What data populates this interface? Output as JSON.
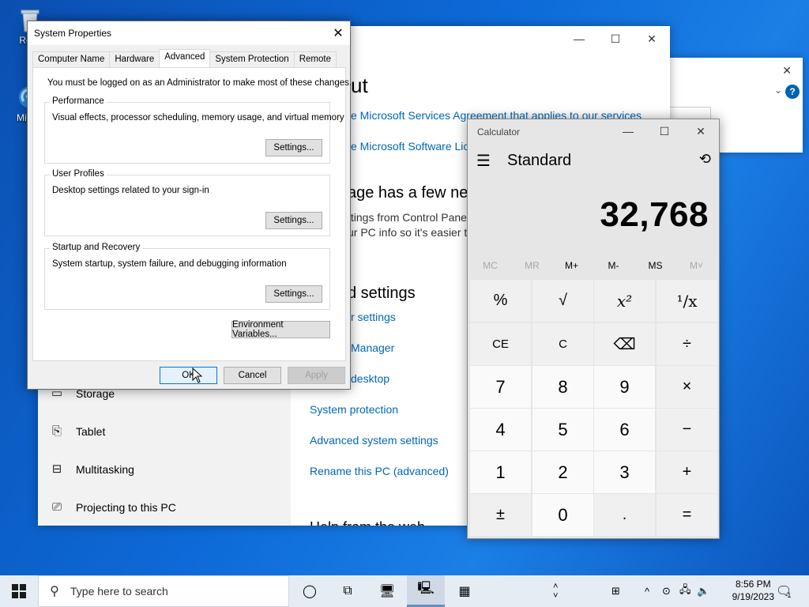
{
  "desktop": {
    "icons": [
      {
        "label": "Recy"
      },
      {
        "label": "Micr E"
      }
    ]
  },
  "settings_window": {
    "heading_about": "ut",
    "links_top": [
      "e Microsoft Services Agreement that applies to our services",
      "e Microsoft Software Lice"
    ],
    "heading_page": "age has a few ne",
    "desc_lines": [
      "ttings from Control Pane",
      "ur PC info so it's easier to"
    ],
    "heading_related": "d settings",
    "related_links": [
      "r settings",
      "Manager",
      "desktop",
      "System protection",
      "Advanced system settings",
      "Rename this PC (advanced)"
    ],
    "help_heading": "Help from the web",
    "nav": [
      {
        "label": "Storage",
        "icon": "storage-icon"
      },
      {
        "label": "Tablet",
        "icon": "tablet-icon"
      },
      {
        "label": "Multitasking",
        "icon": "multitasking-icon"
      },
      {
        "label": "Projecting to this PC",
        "icon": "projecting-icon"
      }
    ]
  },
  "system_properties": {
    "title": "System Properties",
    "tabs": [
      "Computer Name",
      "Hardware",
      "Advanced",
      "System Protection",
      "Remote"
    ],
    "active_tab": "Advanced",
    "admin_note": "You must be logged on as an Administrator to make most of these changes.",
    "groups": [
      {
        "label": "Performance",
        "desc": "Visual effects, processor scheduling, memory usage, and virtual memory",
        "button": "Settings..."
      },
      {
        "label": "User Profiles",
        "desc": "Desktop settings related to your sign-in",
        "button": "Settings..."
      },
      {
        "label": "Startup and Recovery",
        "desc": "System startup, system failure, and debugging information",
        "button": "Settings..."
      }
    ],
    "env_button": "Environment Variables...",
    "ok": "OK",
    "cancel": "Cancel",
    "apply": "Apply"
  },
  "calculator": {
    "title": "Calculator",
    "mode": "Standard",
    "display": "32,768",
    "memory": [
      "MC",
      "MR",
      "M+",
      "M-",
      "MS",
      "M˅"
    ],
    "keys": [
      [
        "%",
        "√",
        "x²",
        "¹/x"
      ],
      [
        "CE",
        "C",
        "⌫",
        "÷"
      ],
      [
        "7",
        "8",
        "9",
        "×"
      ],
      [
        "4",
        "5",
        "6",
        "−"
      ],
      [
        "1",
        "2",
        "3",
        "+"
      ],
      [
        "±",
        "0",
        ".",
        "="
      ]
    ]
  },
  "taskbar": {
    "search_placeholder": "Type here to search",
    "time": "8:56 PM",
    "date": "9/19/2023",
    "notification_count": "1"
  }
}
